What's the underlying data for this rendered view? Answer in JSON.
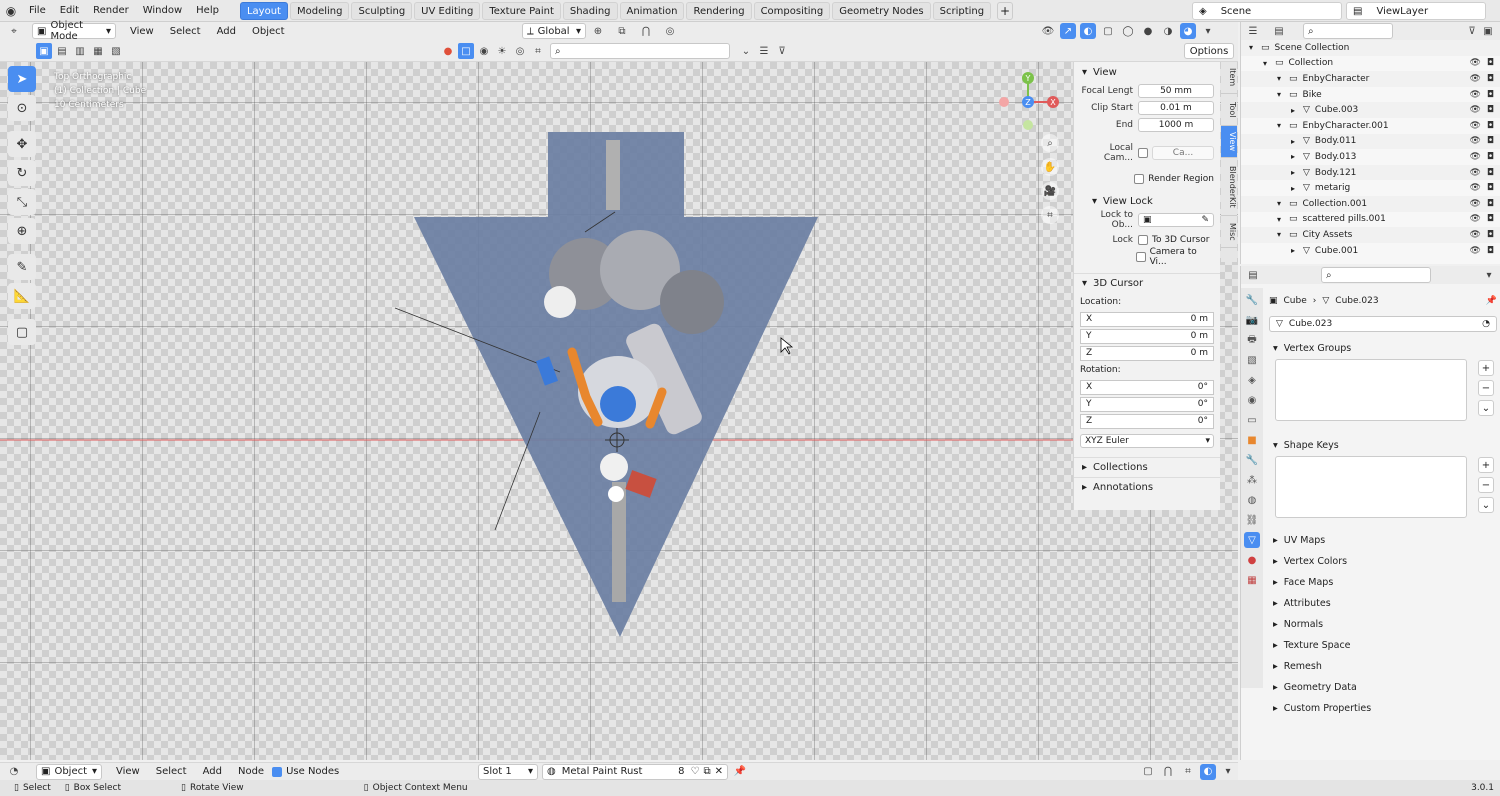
{
  "topbar": {
    "menus": [
      "File",
      "Edit",
      "Render",
      "Window",
      "Help"
    ],
    "workspaces": [
      "Layout",
      "Modeling",
      "Sculpting",
      "UV Editing",
      "Texture Paint",
      "Shading",
      "Animation",
      "Rendering",
      "Compositing",
      "Geometry Nodes",
      "Scripting"
    ],
    "active_workspace": "Layout",
    "scene": "Scene",
    "view_layer": "ViewLayer"
  },
  "viewport_header": {
    "mode": "Object Mode",
    "menus": [
      "View",
      "Select",
      "Add",
      "Object"
    ],
    "orientation": "Global",
    "options_label": "Options"
  },
  "viewport_info": {
    "line1": "Top Orthographic",
    "line2": "(1) Collection | Cube",
    "line3": "10 Centimeters"
  },
  "npanel": {
    "view_header": "View",
    "focal_length_label": "Focal Lengt",
    "focal_length": "50 mm",
    "clip_start_label": "Clip Start",
    "clip_start": "0.01 m",
    "clip_end_label": "End",
    "clip_end": "1000 m",
    "local_camera_label": "Local Cam...",
    "local_camera_value": "Ca...",
    "render_region_label": "Render Region",
    "view_lock_header": "View Lock",
    "lock_to_object_label": "Lock to Ob...",
    "lock_label": "Lock",
    "to_3d_cursor": "To 3D Cursor",
    "camera_to_view": "Camera to Vi...",
    "cursor_header": "3D Cursor",
    "location_label": "Location:",
    "loc_x_label": "X",
    "loc_x": "0 m",
    "loc_y_label": "Y",
    "loc_y": "0 m",
    "loc_z_label": "Z",
    "loc_z": "0 m",
    "rotation_label": "Rotation:",
    "rot_x_label": "X",
    "rot_x": "0°",
    "rot_y_label": "Y",
    "rot_y": "0°",
    "rot_z_label": "Z",
    "rot_z": "0°",
    "rotation_mode": "XYZ Euler",
    "collections_header": "Collections",
    "annotations_header": "Annotations",
    "tabs": [
      "Item",
      "Tool",
      "View",
      "BlenderKit",
      "Misc"
    ],
    "active_tab": "View"
  },
  "outliner": {
    "rows": [
      {
        "label": "Scene Collection",
        "indent": 0
      },
      {
        "label": "Collection",
        "indent": 1
      },
      {
        "label": "EnbyCharacter",
        "indent": 2
      },
      {
        "label": "Bike",
        "indent": 2
      },
      {
        "label": "Cube.003",
        "indent": 3
      },
      {
        "label": "EnbyCharacter.001",
        "indent": 2
      },
      {
        "label": "Body.011",
        "indent": 3
      },
      {
        "label": "Body.013",
        "indent": 3
      },
      {
        "label": "Body.121",
        "indent": 3
      },
      {
        "label": "metarig",
        "indent": 3
      },
      {
        "label": "Collection.001",
        "indent": 2
      },
      {
        "label": "scattered pills.001",
        "indent": 2
      },
      {
        "label": "City Assets",
        "indent": 2
      },
      {
        "label": "Cube.001",
        "indent": 3
      }
    ]
  },
  "properties": {
    "breadcrumb_object": "Cube",
    "breadcrumb_mesh": "Cube.023",
    "mesh_name": "Cube.023",
    "sections": {
      "vertex_groups": "Vertex Groups",
      "shape_keys": "Shape Keys"
    },
    "collapsed_sections": [
      "UV Maps",
      "Vertex Colors",
      "Face Maps",
      "Attributes",
      "Normals",
      "Texture Space",
      "Remesh",
      "Geometry Data",
      "Custom Properties"
    ]
  },
  "bottombar": {
    "mode": "Object",
    "menus": [
      "View",
      "Select",
      "Add",
      "Node"
    ],
    "use_nodes_label": "Use Nodes",
    "slot": "Slot 1",
    "material": "Metal Paint Rust",
    "user_count": "8"
  },
  "statusbar": {
    "select": "Select",
    "box_select": "Box Select",
    "rotate_view": "Rotate View",
    "context_menu": "Object Context Menu",
    "version": "3.0.1"
  }
}
